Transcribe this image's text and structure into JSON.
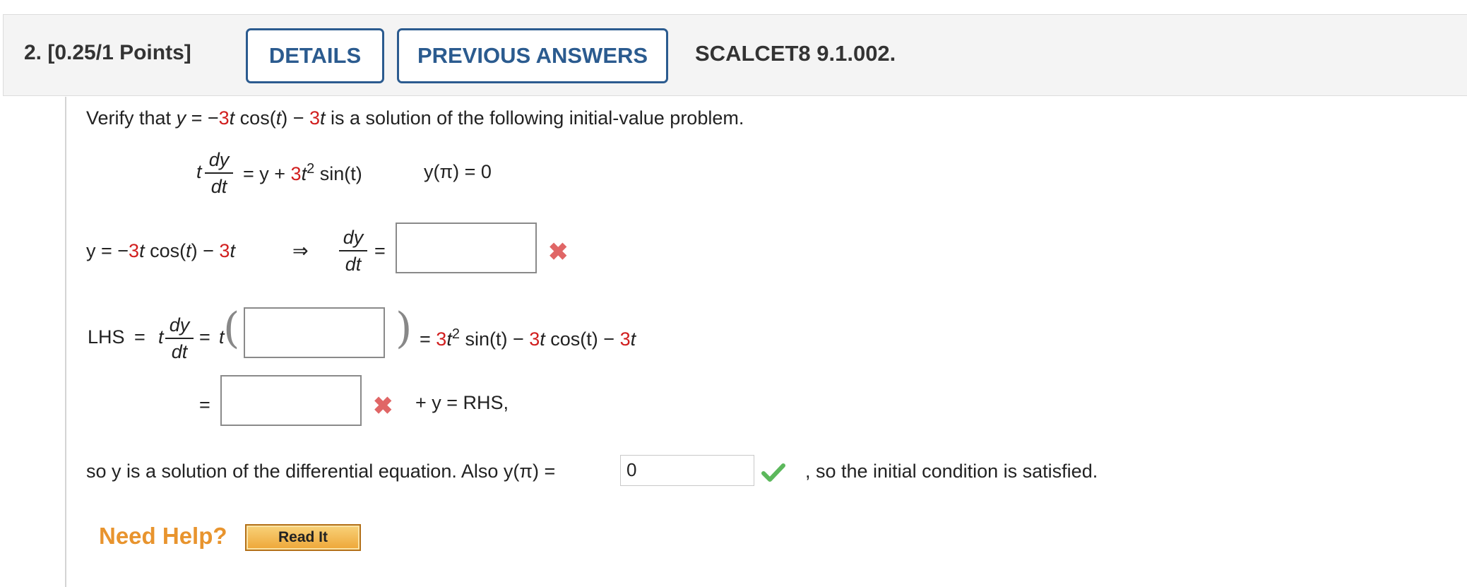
{
  "question": {
    "number_points": "2. [0.25/1 Points]",
    "details_label": "DETAILS",
    "previous_answers_label": "PREVIOUS ANSWERS",
    "reference": "SCALCET8 9.1.002."
  },
  "problem": {
    "intro_prefix": "Verify that ",
    "intro_equation_y": "y",
    "intro_eq": " = −",
    "coef": "3",
    "t": "t",
    "cos_t": " cos(",
    "close": ")",
    "minus": " − ",
    "intro_suffix": " is a solution of the following initial-value problem.",
    "ode_rhs": "= y + ",
    "sin_t": " sin(t)",
    "initial": "y(π) = 0",
    "dy": "dy",
    "dt": "dt"
  },
  "step1": {
    "lhs": "y = −",
    "arrow": "⇒",
    "eq": "="
  },
  "step2": {
    "lhs_label": "LHS",
    "eq": "=",
    "rhs_text_a": "= ",
    "rhs_text_b": " sin(t) − ",
    "rhs_text_c": " cos(t) − "
  },
  "step3": {
    "eq": "=",
    "plus_y_rhs": "+ y = RHS,"
  },
  "conclusion": {
    "prefix": "so y is a solution of the differential equation. Also y(π) =",
    "answer_value": "0",
    "suffix": ", so the initial condition is satisfied."
  },
  "help": {
    "need_help": "Need Help?",
    "read_it": "Read It"
  },
  "colors": {
    "accent": "#2b5b8f",
    "red_coef": "#d11f1f",
    "wrong": "#e06666",
    "correct": "#5cb85c",
    "help": "#e8942e"
  },
  "status_icons": [
    "wrong-x-icon",
    "wrong-x-icon",
    "correct-check-icon"
  ]
}
